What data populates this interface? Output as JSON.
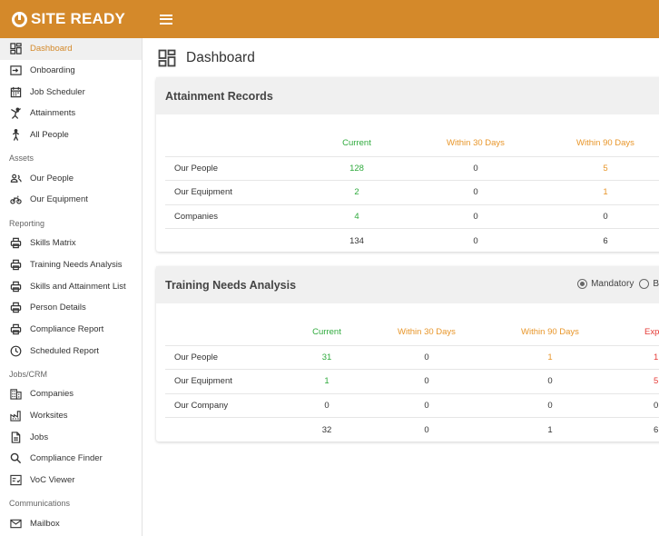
{
  "app": {
    "logo_text": "SITE READY"
  },
  "colors": {
    "brand": "#d4892a",
    "green": "#2eaa3c",
    "orange": "#e8962a",
    "red": "#e53935"
  },
  "sidebar": {
    "top": [
      {
        "label": "Dashboard",
        "icon": "dashboard-icon",
        "active": true
      },
      {
        "label": "Onboarding",
        "icon": "login-icon"
      },
      {
        "label": "Job Scheduler",
        "icon": "calendar-icon"
      },
      {
        "label": "Attainments",
        "icon": "karate-icon"
      },
      {
        "label": "All People",
        "icon": "walk-icon"
      }
    ],
    "assets_label": "Assets",
    "assets": [
      {
        "label": "Our People",
        "icon": "people-icon"
      },
      {
        "label": "Our Equipment",
        "icon": "bike-icon"
      }
    ],
    "reporting_label": "Reporting",
    "reporting": [
      {
        "label": "Skills Matrix",
        "icon": "print-icon"
      },
      {
        "label": "Training Needs Analysis",
        "icon": "print-icon"
      },
      {
        "label": "Skills and Attainment List",
        "icon": "print-icon"
      },
      {
        "label": "Person Details",
        "icon": "print-icon"
      },
      {
        "label": "Compliance Report",
        "icon": "print-icon"
      },
      {
        "label": "Scheduled Report",
        "icon": "clock-icon"
      }
    ],
    "jobs_label": "Jobs/CRM",
    "jobs": [
      {
        "label": "Companies",
        "icon": "building-icon"
      },
      {
        "label": "Worksites",
        "icon": "factory-icon"
      },
      {
        "label": "Jobs",
        "icon": "document-icon"
      },
      {
        "label": "Compliance Finder",
        "icon": "search-icon"
      },
      {
        "label": "VoC Viewer",
        "icon": "checklist-icon"
      }
    ],
    "comms_label": "Communications",
    "comms": [
      {
        "label": "Mailbox",
        "icon": "mail-icon"
      }
    ]
  },
  "page": {
    "title": "Dashboard"
  },
  "attainment": {
    "title": "Attainment Records",
    "headers": [
      "Current",
      "Within 30 Days",
      "Within 90 Days"
    ],
    "rows": [
      {
        "label": "Our People",
        "current": "128",
        "d30": "0",
        "d90": "5"
      },
      {
        "label": "Our Equipment",
        "current": "2",
        "d30": "0",
        "d90": "1"
      },
      {
        "label": "Companies",
        "current": "4",
        "d30": "0",
        "d90": "0"
      }
    ],
    "totals": {
      "current": "134",
      "d30": "0",
      "d90": "6"
    }
  },
  "tna": {
    "title": "Training Needs Analysis",
    "radio_mandatory": "Mandatory",
    "radio_other": "B",
    "headers": [
      "Current",
      "Within 30 Days",
      "Within 90 Days",
      "Expire"
    ],
    "rows": [
      {
        "label": "Our People",
        "current": "31",
        "d30": "0",
        "d90": "1",
        "exp": "1"
      },
      {
        "label": "Our Equipment",
        "current": "1",
        "d30": "0",
        "d90": "0",
        "exp": "5"
      },
      {
        "label": "Our Company",
        "current": "0",
        "d30": "0",
        "d90": "0",
        "exp": "0"
      }
    ],
    "totals": {
      "current": "32",
      "d30": "0",
      "d90": "1",
      "exp": "6"
    }
  }
}
